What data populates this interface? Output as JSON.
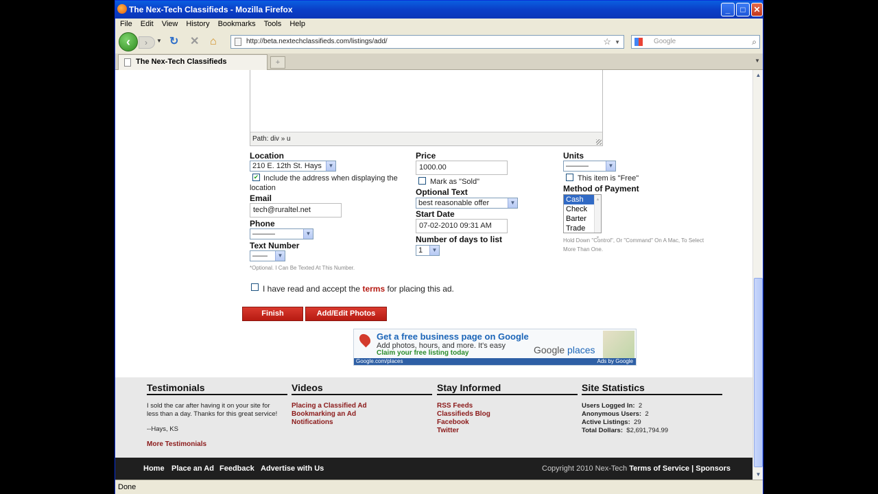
{
  "window": {
    "title": "The Nex-Tech Classifieds - Mozilla Firefox"
  },
  "menu": [
    "File",
    "Edit",
    "View",
    "History",
    "Bookmarks",
    "Tools",
    "Help"
  ],
  "nav": {
    "url": "http://beta.nextechclassifieds.com/listings/add/",
    "search_placeholder": "Google"
  },
  "tab": {
    "title": "The Nex-Tech Classifieds"
  },
  "status": "Done",
  "editor": {
    "path": "Path: div » u"
  },
  "form": {
    "location_label": "Location",
    "location_value": "210 E. 12th St. Hays",
    "include_address": "Include the address when displaying the",
    "include_address_2": "location",
    "email_label": "Email",
    "email_value": "tech@ruraltel.net",
    "phone_label": "Phone",
    "phone_value": "———",
    "text_label": "Text Number",
    "text_value": "——",
    "text_hint": "*Optional. I Can Be Texted At This Number.",
    "price_label": "Price",
    "price_value": "1000.00",
    "mark_sold": "Mark as \"Sold\"",
    "optional_label": "Optional Text",
    "optional_value": "best reasonable offer",
    "start_label": "Start Date",
    "start_value": "07-02-2010 09:31 AM",
    "days_label": "Number of days to list",
    "days_value": "1",
    "units_label": "Units",
    "units_value": "———",
    "free_label": "This item is \"Free\"",
    "payment_label": "Method of Payment",
    "payment_options": [
      "Cash",
      "Check",
      "Barter",
      "Trade"
    ],
    "payment_hint_1": "Hold Down \"Control\", Or \"Command\" On A Mac, To Select",
    "payment_hint_2": "More Than One.",
    "terms_pre": "I have read and accept the",
    "terms_link": "terms",
    "terms_post": "for placing this ad.",
    "finish": "Finish",
    "photos": "Add/Edit Photos"
  },
  "ad": {
    "headline": "Get a free business page on Google",
    "line1": "Add photos, hours, and more. It's easy",
    "line2": "Claim your free listing today",
    "brand_1": "Google",
    "brand_2": "places",
    "foot_left": "Google.com/places",
    "foot_right": "Ads by Google"
  },
  "footer": {
    "testimonials_title": "Testimonials",
    "testimonial_1": "I sold the car after having it on your site for",
    "testimonial_2": "less than a day. Thanks for this great service!",
    "testimonial_author": "--Hays, KS",
    "more_testimonials": "More Testimonials",
    "videos_title": "Videos",
    "videos": [
      "Placing a Classified Ad",
      "Bookmarking an Ad",
      "Notifications"
    ],
    "stay_title": "Stay Informed",
    "stay": [
      "RSS Feeds",
      "Classifieds Blog",
      "Facebook",
      "Twitter"
    ],
    "stats_title": "Site Statistics",
    "stats": [
      {
        "label": "Users Logged In:",
        "value": "2"
      },
      {
        "label": "Anonymous Users:",
        "value": "2"
      },
      {
        "label": "Active Listings:",
        "value": "29"
      },
      {
        "label": "Total Dollars:",
        "value": "$2,691,794.99"
      }
    ]
  },
  "bottom": {
    "links": [
      "Home",
      "Place an Ad",
      "Feedback",
      "Advertise with Us"
    ],
    "copyright": "Copyright 2010 Nex-Tech",
    "tos": "Terms of Service",
    "sep": "|",
    "sponsors": "Sponsors"
  }
}
